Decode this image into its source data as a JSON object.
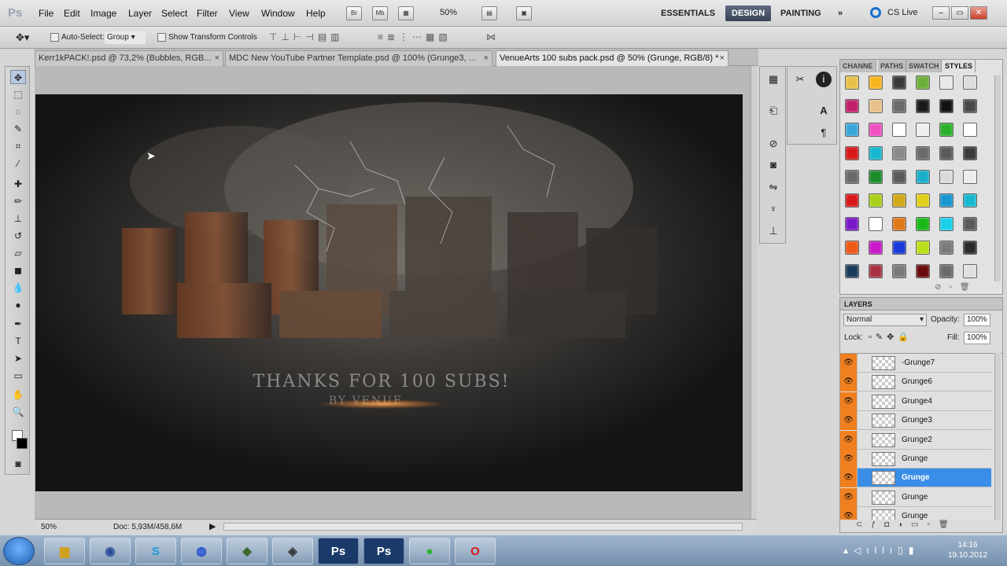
{
  "app": {
    "logo": "Ps"
  },
  "menu": {
    "items": [
      "File",
      "Edit",
      "Image",
      "Layer",
      "Select",
      "Filter",
      "View",
      "Window",
      "Help"
    ]
  },
  "titlebar": {
    "zoom": "50%",
    "workspaces": [
      "ESSENTIALS",
      "DESIGN",
      "PAINTING"
    ],
    "active_workspace": "DESIGN",
    "more": "»",
    "cs_live": "CS Live",
    "mini_buttons": [
      "Br",
      "Mb"
    ]
  },
  "options": {
    "auto_select_label": "Auto-Select:",
    "auto_select_value": "Group",
    "transform_label": "Show Transform Controls"
  },
  "tabs": [
    {
      "label": "Kerr1kPACK!.psd @ 73,2% (Bubbles, RGB...",
      "close": "×"
    },
    {
      "label": "MDC New YouTube Partner Template.psd @ 100% (Grunge3, ...",
      "close": "×"
    },
    {
      "label": "VenueArts 100 subs pack.psd @ 50% (Grunge, RGB/8) *",
      "close": "×"
    }
  ],
  "artwork": {
    "line1": "THANKS FOR 100 SUBS!",
    "line2": "BY VENUE"
  },
  "status": {
    "zoom": "50%",
    "doc": "Doc: 5,93M/458,6M"
  },
  "styles_panel": {
    "tabs": [
      "CHANNE",
      "PATHS",
      "SWATCH",
      "STYLES"
    ],
    "active_tab": "STYLES",
    "swatches": [
      "#e7c14a",
      "#f7b520",
      "#3a3a3a",
      "#6cae3a",
      "#e8e8e8",
      "#dcdcdc",
      "#c0206a",
      "#e7c08a",
      "#6a6a6a",
      "#1a1a1a",
      "#111111",
      "#4a4a4a",
      "#3aa6d8",
      "#f04fc0",
      "#ffffff",
      "#efefef",
      "#2ab02a",
      "#ffffff",
      "#d81818",
      "#18b8d0",
      "#8a8a8a",
      "#6a6a6a",
      "#5a5a5a",
      "#3a3a3a",
      "#6a6a6a",
      "#1a8a2a",
      "#5a5a5a",
      "#18b0c8",
      "#dadada",
      "#ececec",
      "#d81818",
      "#a8d018",
      "#d0a818",
      "#e0d018",
      "#1898d0",
      "#18b8d0",
      "#7a18c8",
      "#ffffff",
      "#e07818",
      "#18b818",
      "#18d0e8",
      "#5a5a5a",
      "#f05818",
      "#c818c8",
      "#1838d8",
      "#b8e018",
      "#7a7a7a",
      "#2a2a2a",
      "#1a3a5a",
      "#a83040",
      "#7a7a7a",
      "#6a0a0a",
      "#6a6a6a",
      "#e0e0e0"
    ]
  },
  "layers_panel": {
    "title": "LAYERS",
    "blend_mode": "Normal",
    "opacity_label": "Opacity:",
    "opacity": "100%",
    "lock_label": "Lock:",
    "fill_label": "Fill:",
    "fill": "100%",
    "layers": [
      {
        "name": "-Grunge7",
        "selected": false
      },
      {
        "name": "Grunge6",
        "selected": false
      },
      {
        "name": "Grunge4",
        "selected": false
      },
      {
        "name": "Grunge3",
        "selected": false
      },
      {
        "name": "Grunge2",
        "selected": false
      },
      {
        "name": "Grunge",
        "selected": false
      },
      {
        "name": "Grunge",
        "selected": true
      },
      {
        "name": "Grunge",
        "selected": false
      },
      {
        "name": "Grunge",
        "selected": false
      }
    ]
  },
  "taskbar": {
    "time": "14:16",
    "date": "19.10.2012",
    "ps_labels": [
      "Ps",
      "Ps"
    ]
  }
}
